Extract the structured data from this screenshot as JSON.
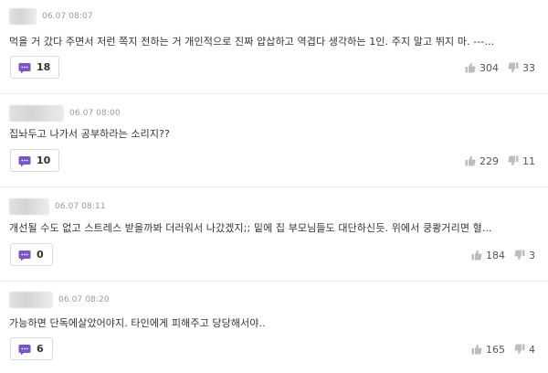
{
  "comments": [
    {
      "date": "06.07 08:07",
      "text": "먹을 거 갔다 주면서 저런 쪽지 전하는 거 개인적으로 진짜 얍삽하고 역겹다 생각하는 1인. 주지 말고 뛰지 마. ---...",
      "replies": "18",
      "likes": "304",
      "dislikes": "33"
    },
    {
      "date": "06.07 08:00",
      "text": "집놔두고 나가서 공부하라는 소리지??",
      "replies": "10",
      "likes": "229",
      "dislikes": "11"
    },
    {
      "date": "06.07 08:11",
      "text": "개선될 수도 없고 스트레스 받을까봐 더러워서 나갔겠지;; 밑에 집 부모님들도 대단하신듯. 위에서 쿵쾅거리면 혈...",
      "replies": "0",
      "likes": "184",
      "dislikes": "3"
    },
    {
      "date": "06.07 08:20",
      "text": "가능하면 단독에살았어야지. 타인에게 피해주고 당당해서야..",
      "replies": "6",
      "likes": "165",
      "dislikes": "4"
    }
  ],
  "colors": {
    "reply_icon": "#7b52d1",
    "vote_icon": "#bdbdbd"
  }
}
